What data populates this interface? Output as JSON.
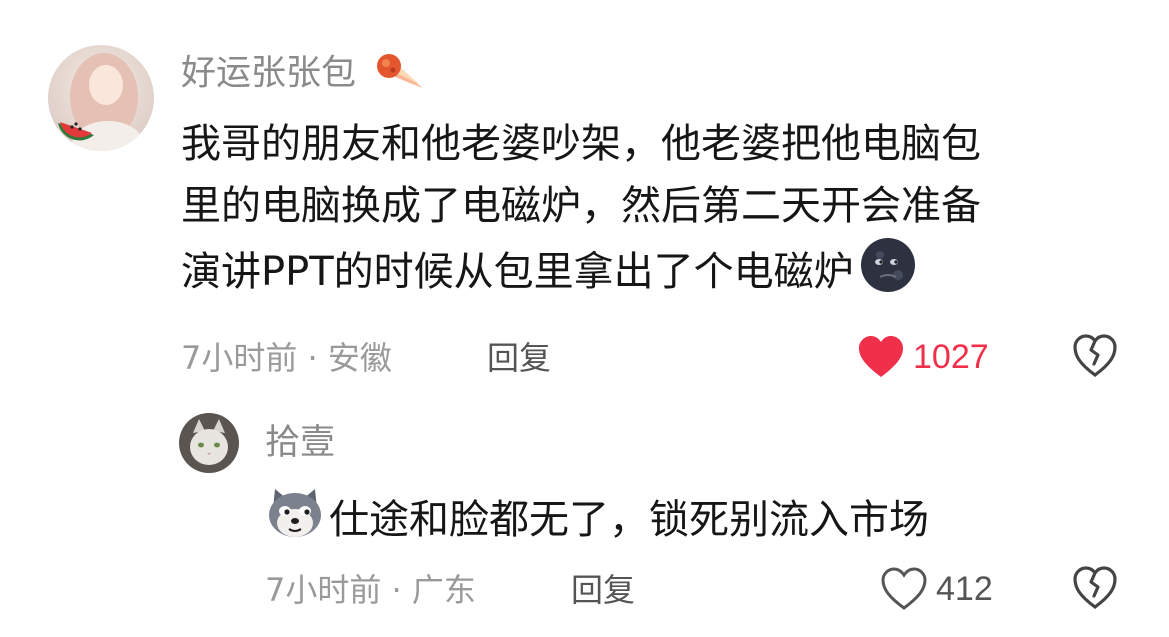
{
  "comments": [
    {
      "username": "好运张张包",
      "username_badge_icon": "fire-meteor-icon",
      "text_lines": [
        "我哥的朋友和他老婆吵架，他老婆把他电脑包",
        "里的电脑换成了电磁炉，然后第二天开会准备",
        "演讲PPT的时候从包里拿出了个电磁炉"
      ],
      "trailing_emoji_icon": "new-moon-face-icon",
      "meta": "7小时前 · 安徽",
      "reply_label": "回复",
      "like_count": "1027",
      "liked": true,
      "like_color": "#f0304a"
    },
    {
      "username": "拾壹",
      "leading_emoji_icon": "doge-face-icon",
      "text": "仕途和脸都无了，锁死别流入市场",
      "meta": "7小时前 · 广东",
      "reply_label": "回复",
      "like_count": "412",
      "liked": false,
      "like_color": "#555555"
    }
  ]
}
